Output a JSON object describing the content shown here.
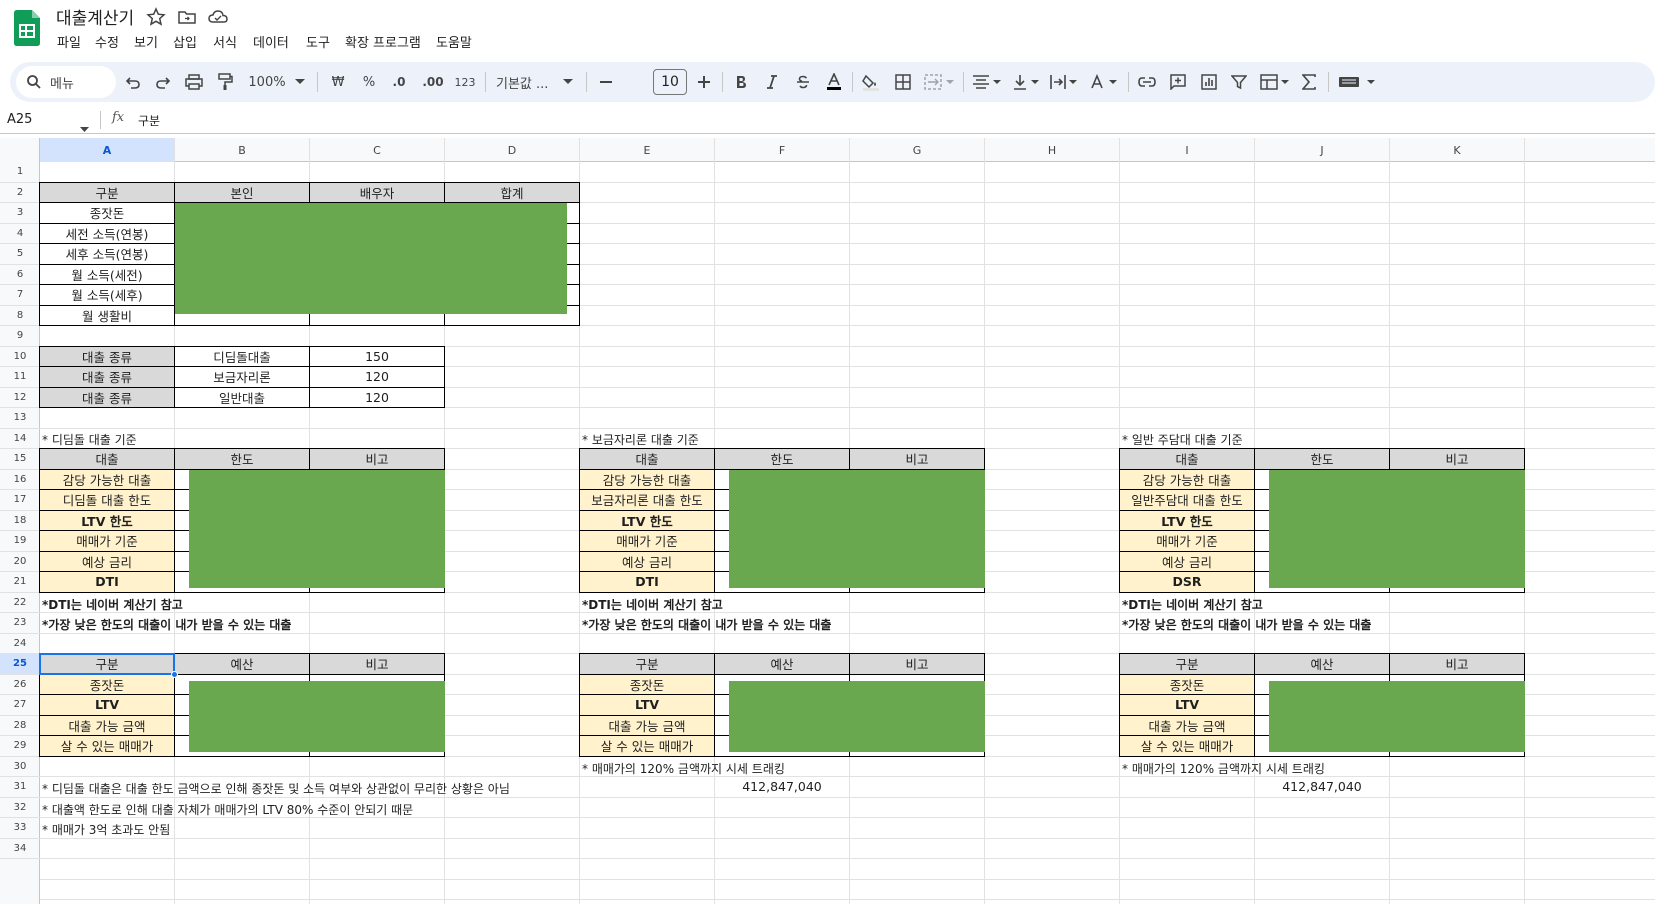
{
  "doc": {
    "title": "대출계산기"
  },
  "menu": [
    "파일",
    "수정",
    "보기",
    "삽입",
    "서식",
    "데이터",
    "도구",
    "확장 프로그램",
    "도움말"
  ],
  "toolbar": {
    "search_placeholder": "메뉴",
    "zoom": "100%",
    "currency": "₩",
    "percent": "%",
    "dec_decrease": ".0",
    "dec_increase": ".00",
    "format_123": "123",
    "font_name": "기본값 ...",
    "font_size": "10"
  },
  "formula_bar": {
    "cell_ref": "A25",
    "fx": "fx",
    "content": "구분"
  },
  "columns": [
    "A",
    "B",
    "C",
    "D",
    "E",
    "F",
    "G",
    "H",
    "I",
    "J",
    "K"
  ],
  "rows": [
    "1",
    "2",
    "3",
    "4",
    "5",
    "6",
    "7",
    "8",
    "9",
    "10",
    "11",
    "12",
    "13",
    "14",
    "15",
    "16",
    "17",
    "18",
    "19",
    "20",
    "21",
    "22",
    "23",
    "24",
    "25",
    "26",
    "27",
    "28",
    "29",
    "30",
    "31",
    "32",
    "33",
    "34"
  ],
  "income_table": {
    "headers": [
      "구분",
      "본인",
      "배우자",
      "합계"
    ],
    "labels": [
      "종잣돈",
      "세전 소득(연봉)",
      "세후 소득(연봉)",
      "월 소득(세전)",
      "월 소득(세후)",
      "월 생활비"
    ]
  },
  "loan_types": [
    {
      "label": "대출 종류",
      "name": "디딤돌대출",
      "value": "150"
    },
    {
      "label": "대출 종류",
      "name": "보금자리론",
      "value": "120"
    },
    {
      "label": "대출 종류",
      "name": "일반대출",
      "value": "120"
    }
  ],
  "sections": [
    {
      "heading": "* 디딤돌 대출 기준",
      "headers": [
        "대출",
        "한도",
        "비고"
      ],
      "labels": [
        "감당 가능한 대출",
        "디딤돌 대출 한도",
        "LTV 한도",
        "매매가 기준",
        "예상 금리",
        "DTI"
      ],
      "note1": "*DTI는 네이버 계산기 참고",
      "note2": "*가장 낮은 한도의 대출이 내가 받을 수 있는 대출",
      "budget_headers": [
        "구분",
        "예산",
        "비고"
      ],
      "budget_labels": [
        "종잣돈",
        "LTV",
        "대출 가능 금액",
        "살 수 있는 매매가"
      ]
    },
    {
      "heading": "* 보금자리론 대출 기준",
      "headers": [
        "대출",
        "한도",
        "비고"
      ],
      "labels": [
        "감당 가능한 대출",
        "보금자리론 대출 한도",
        "LTV 한도",
        "매매가 기준",
        "예상 금리",
        "DTI"
      ],
      "note1": "*DTI는 네이버 계산기 참고",
      "note2": "*가장 낮은 한도의 대출이 내가 받을 수 있는 대출",
      "budget_headers": [
        "구분",
        "예산",
        "비고"
      ],
      "budget_labels": [
        "종잣돈",
        "LTV",
        "대출 가능 금액",
        "살 수 있는 매매가"
      ],
      "tracking_note": "* 매매가의 120% 금액까지 시세 트래킹",
      "tracking_value": "412,847,040"
    },
    {
      "heading": "* 일반 주담대 대출 기준",
      "headers": [
        "대출",
        "한도",
        "비고"
      ],
      "labels": [
        "감당 가능한 대출",
        "일반주담대 대출 한도",
        "LTV 한도",
        "매매가 기준",
        "예상 금리",
        "DSR"
      ],
      "note1": "*DTI는 네이버 계산기 참고",
      "note2": "*가장 낮은 한도의 대출이 내가 받을 수 있는 대출",
      "budget_headers": [
        "구분",
        "예산",
        "비고"
      ],
      "budget_labels": [
        "종잣돈",
        "LTV",
        "대출 가능 금액",
        "살 수 있는 매매가"
      ],
      "tracking_note": "* 매매가의 120% 금액까지 시세 트래킹",
      "tracking_value": "412,847,040"
    }
  ],
  "footnotes": [
    "* 디딤돌 대출은 대출 한도 금액으로 인해 종잣돈 및 소득 여부와 상관없이 무리한 상황은 아님",
    "* 대출액 한도로 인해 대출 자체가 매매가의 LTV 80% 수준이 안되기 때문",
    "* 매매가 3억 초과도 안됨"
  ],
  "colors": {
    "header_gray": "#d9d9d9",
    "label_yellow": "#fff2cc",
    "redaction_green": "#6aa84f",
    "note_red": "#ff0000",
    "selection_blue": "#1a73e8"
  }
}
